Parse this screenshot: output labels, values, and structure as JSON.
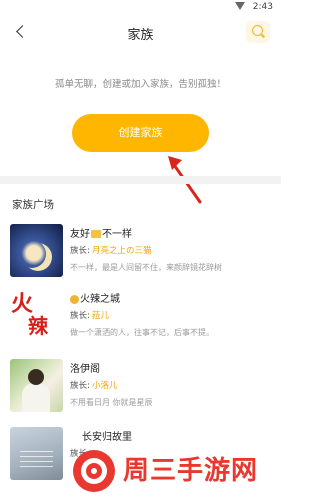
{
  "status_bar": {
    "time": "2:43",
    "icons": [
      "wifi-icon",
      "battery-icon"
    ]
  },
  "header": {
    "title": "家族",
    "back_icon": "back-chevron-icon",
    "search_icon": "search-icon"
  },
  "intro_text": "孤单无聊，创建或加入家族，告别孤独！",
  "create_button": {
    "label": "创建家族"
  },
  "section_title": "家族广场",
  "leader_label": "族长:",
  "families": [
    {
      "name_pre": "友好",
      "name_post": "不一样",
      "leader": "月亮之上の三猫",
      "desc": "不一样，最是人间留不住，来颜辞镜花辞树"
    },
    {
      "name_pre": "",
      "name_post": "火辣之城",
      "leader": "菈儿",
      "desc": "做一个潇洒的人，往事不记，后事不提。"
    },
    {
      "name_pre": "",
      "name_post": "洛伊阁",
      "leader": "小洛儿",
      "desc": "不用看日月 你就是星辰"
    },
    {
      "name_pre": "",
      "name_post": "长安归故里",
      "leader": "",
      "desc": ""
    }
  ],
  "watermark": {
    "brand": "周三手游网"
  },
  "colors": {
    "accent": "#ffb600",
    "leader": "#f5a300",
    "watermark": "#e8382f"
  }
}
